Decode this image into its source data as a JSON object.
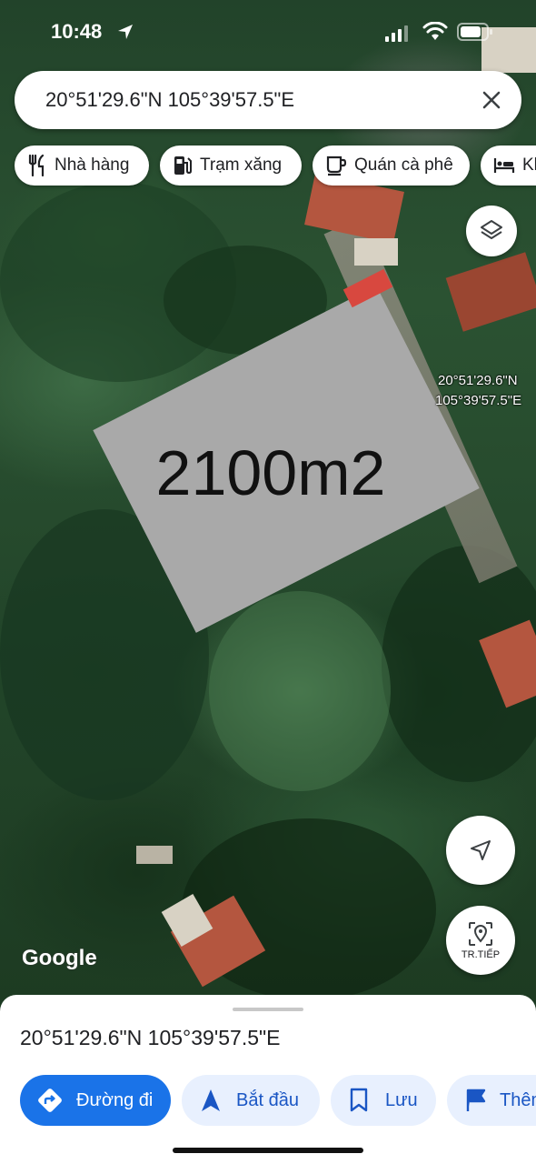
{
  "status_bar": {
    "time": "10:48"
  },
  "search": {
    "query": "20°51'29.6\"N 105°39'57.5\"E"
  },
  "chips": [
    {
      "label": "Nhà hàng",
      "icon": "restaurant-icon"
    },
    {
      "label": "Trạm xăng",
      "icon": "gas-station-icon"
    },
    {
      "label": "Quán cà phê",
      "icon": "coffee-icon"
    },
    {
      "label": "Kh",
      "icon": "hotel-icon"
    }
  ],
  "map": {
    "plot_label": "2100m2",
    "pin_lat": "20°51'29.6\"N",
    "pin_lng": "105°39'57.5\"E",
    "attribution": "Google"
  },
  "controls": {
    "tracking_label": "TR.TIẾP"
  },
  "sheet": {
    "title": "20°51'29.6\"N 105°39'57.5\"E",
    "actions": [
      {
        "label": "Đường đi",
        "icon": "directions-icon"
      },
      {
        "label": "Bắt đầu",
        "icon": "navigation-arrow-icon"
      },
      {
        "label": "Lưu",
        "icon": "bookmark-icon"
      },
      {
        "label": "Thêm",
        "icon": "flag-icon"
      }
    ]
  },
  "colors": {
    "accent": "#1a73e8",
    "plot": "#a9a9a9",
    "plot_corner": "#d8483f"
  }
}
